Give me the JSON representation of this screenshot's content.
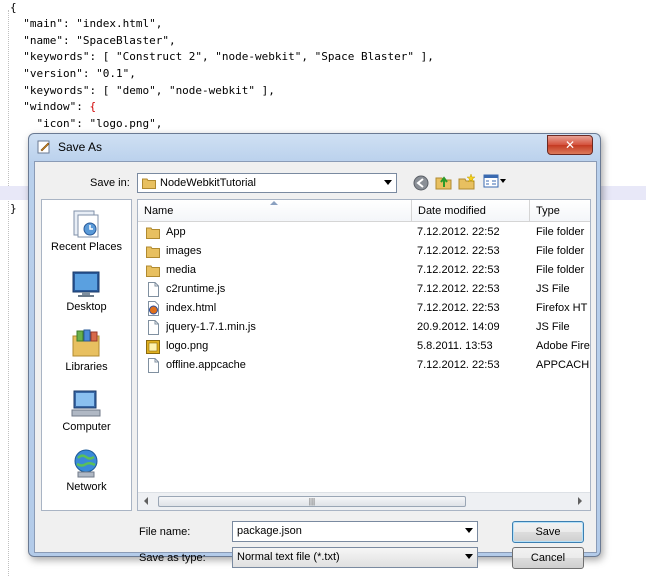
{
  "editor": {
    "lines": [
      "{",
      "  \"main\": \"index.html\",",
      "  \"name\": \"SpaceBlaster\",",
      "  \"keywords\": [ \"Construct 2\", \"node-webkit\", \"Space Blaster\" ],",
      "  \"version\": \"0.1\",",
      "  \"keywords\": [ \"demo\", \"node-webkit\" ],",
      "  \"window\": {",
      "    \"icon\": \"logo.png\","
    ],
    "closing_brace": "}"
  },
  "dialog": {
    "title": "Save As",
    "close_label": "✕",
    "save_in_label": "Save in:",
    "save_in_value": "NodeWebkitTutorial",
    "places": [
      {
        "label": "Recent Places",
        "icon": "recent-places-icon"
      },
      {
        "label": "Desktop",
        "icon": "desktop-icon"
      },
      {
        "label": "Libraries",
        "icon": "libraries-icon"
      },
      {
        "label": "Computer",
        "icon": "computer-icon"
      },
      {
        "label": "Network",
        "icon": "network-icon"
      }
    ],
    "columns": {
      "name": "Name",
      "date": "Date modified",
      "type": "Type"
    },
    "files": [
      {
        "name": "App",
        "date": "7.12.2012. 22:52",
        "type": "File folder",
        "icon": "folder"
      },
      {
        "name": "images",
        "date": "7.12.2012. 22:53",
        "type": "File folder",
        "icon": "folder"
      },
      {
        "name": "media",
        "date": "7.12.2012. 22:53",
        "type": "File folder",
        "icon": "folder"
      },
      {
        "name": "c2runtime.js",
        "date": "7.12.2012. 22:53",
        "type": "JS File",
        "icon": "file"
      },
      {
        "name": "index.html",
        "date": "7.12.2012. 22:53",
        "type": "Firefox HT",
        "icon": "firefox"
      },
      {
        "name": "jquery-1.7.1.min.js",
        "date": "20.9.2012. 14:09",
        "type": "JS File",
        "icon": "file"
      },
      {
        "name": "logo.png",
        "date": "5.8.2011. 13:53",
        "type": "Adobe Fire",
        "icon": "image"
      },
      {
        "name": "offline.appcache",
        "date": "7.12.2012. 22:53",
        "type": "APPCACH",
        "icon": "file"
      }
    ],
    "file_name_label": "File name:",
    "file_name_value": "package.json",
    "save_type_label": "Save as type:",
    "save_type_value": "Normal text file (*.txt)",
    "save_button": "Save",
    "cancel_button": "Cancel"
  },
  "colors": {
    "folder": "#e8c060",
    "accent": "#3c7fb1",
    "keyword_red": "#d00000"
  }
}
